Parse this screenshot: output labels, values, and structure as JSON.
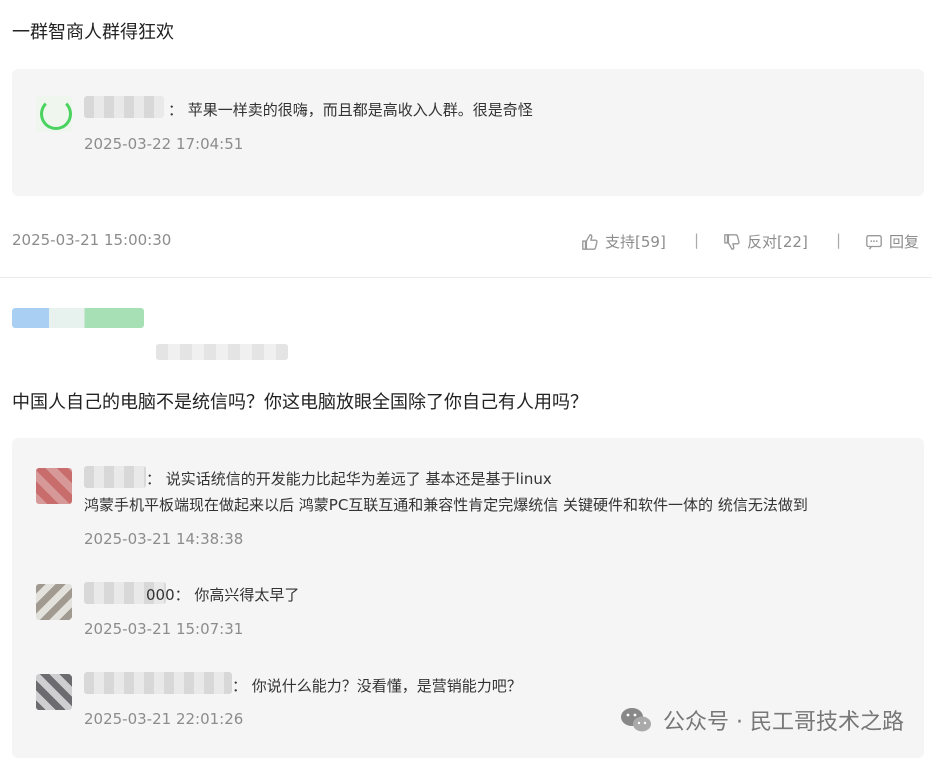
{
  "comment1": {
    "text": "一群智商人群得狂欢",
    "timestamp": "2025-03-21 15:00:30",
    "support_label": "支持[59]",
    "oppose_label": "反对[22]",
    "reply_label": "回复",
    "separator": "|",
    "replies": [
      {
        "text": "：  苹果一样卖的很嗨，而且都是高收入人群。很是奇怪",
        "timestamp": "2025-03-22 17:04:51"
      }
    ]
  },
  "comment2": {
    "text": "中国人自己的电脑不是统信吗？你这电脑放眼全国除了你自己有人用吗？",
    "replies": [
      {
        "text": "：  说实话统信的开发能力比起华为差远了 基本还是基于linux",
        "text2": "鸿蒙手机平板端现在做起来以后 鸿蒙PC互联互通和兼容性肯定完爆统信 关键硬件和软件一体的 统信无法做到",
        "timestamp": "2025-03-21 14:38:38"
      },
      {
        "text": "000：  你高兴得太早了",
        "timestamp": "2025-03-21 15:07:31"
      },
      {
        "text": "：  你说什么能力？没看懂，是营销能力吧？",
        "timestamp": "2025-03-21 22:01:26"
      }
    ]
  },
  "watermark": {
    "text": "公众号 · 民工哥技术之路"
  },
  "icons": {
    "support": "thumbs-up-icon",
    "oppose": "thumbs-down-icon",
    "reply": "comment-icon",
    "watermark": "wechat-icon"
  }
}
